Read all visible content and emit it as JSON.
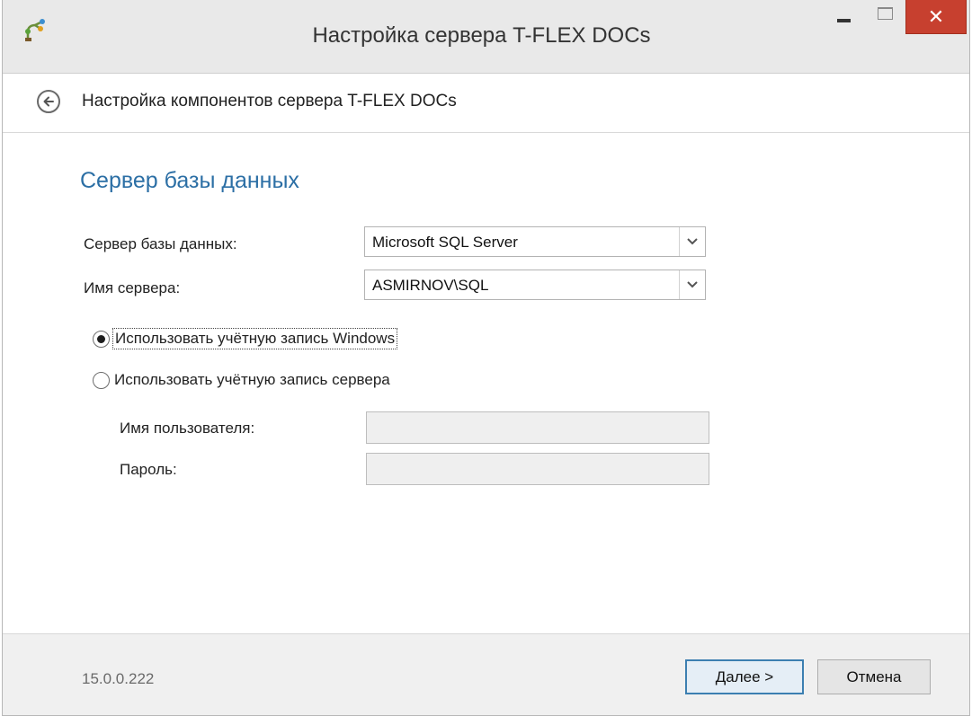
{
  "window": {
    "title": "Настройка сервера T-FLEX DOCs",
    "close_glyph": "✕",
    "accent_color": "#c7402f"
  },
  "header": {
    "title": "Настройка компонентов сервера T-FLEX DOCs",
    "back_icon": "back-arrow-icon"
  },
  "section": {
    "title": "Сервер базы данных",
    "title_color": "#2c6fa5"
  },
  "form": {
    "db_server_label": "Сервер базы данных:",
    "db_server_value": "Microsoft SQL Server",
    "server_name_label": "Имя сервера:",
    "server_name_value": "ASMIRNOV\\SQL",
    "auth_options": [
      {
        "label": "Использовать учётную запись Windows",
        "checked": true
      },
      {
        "label": "Использовать учётную запись сервера",
        "checked": false
      }
    ],
    "username_label": "Имя пользователя:",
    "username_value": "",
    "password_label": "Пароль:",
    "password_value": ""
  },
  "footer": {
    "version": "15.0.0.222",
    "next_label": "Далее >",
    "cancel_label": "Отмена"
  }
}
